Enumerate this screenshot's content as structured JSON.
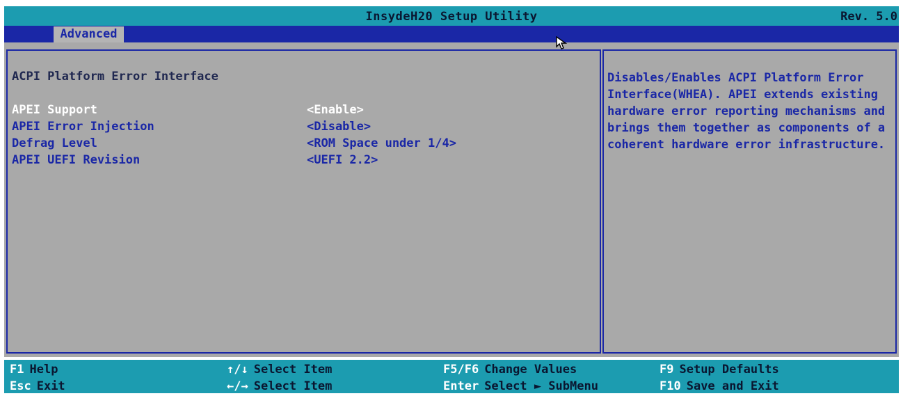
{
  "header": {
    "title": "InsydeH20 Setup Utility",
    "revision": "Rev. 5.0"
  },
  "tabs": [
    {
      "label": "Advanced",
      "active": true
    }
  ],
  "main": {
    "section_title": "ACPI Platform Error Interface",
    "items": [
      {
        "label": "APEI Support",
        "value": "<Enable>",
        "selected": true
      },
      {
        "label": "APEI Error Injection",
        "value": "<Disable>"
      },
      {
        "label": "Defrag Level",
        "value": "<ROM Space under 1/4>"
      },
      {
        "label": "APEI UEFI Revision",
        "value": "<UEFI 2.2>"
      }
    ]
  },
  "help": {
    "text": "Disables/Enables ACPI Platform Error\nInterface(WHEA).  APEI extends existing\nhardware error reporting mechanisms and\nbrings them together as components of a\ncoherent hardware error infrastructure."
  },
  "footer": [
    {
      "key": "F1",
      "desc": "Help"
    },
    {
      "key": "Esc",
      "desc": "Exit"
    },
    {
      "key": "↑/↓",
      "desc": "Select Item"
    },
    {
      "key": "←/→",
      "desc": "Select Item"
    },
    {
      "key": "F5/F6",
      "desc": "Change Values"
    },
    {
      "key": "Enter",
      "desc": "Select ► SubMenu"
    },
    {
      "key": "F9",
      "desc": "Setup Defaults"
    },
    {
      "key": "F10",
      "desc": "Save and Exit"
    }
  ],
  "colors": {
    "title_bar": "#1c9cb0",
    "tab_bar": "#1a27a6",
    "panel": "#a9a9a9",
    "text_blue": "#1a27a6",
    "highlight": "#ffffff"
  },
  "icons": {
    "cursor": "mouse-pointer-icon"
  }
}
